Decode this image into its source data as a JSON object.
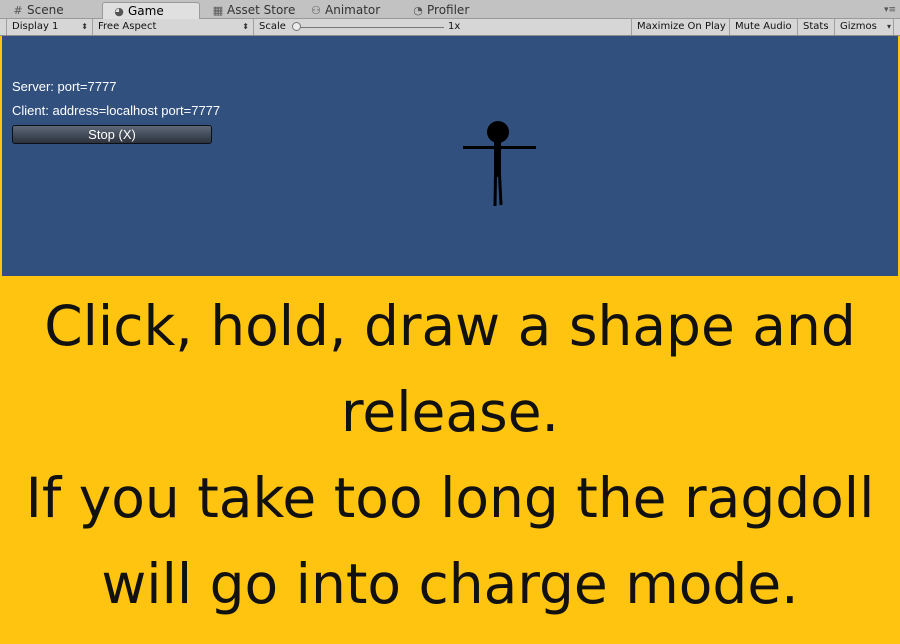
{
  "tabs": [
    {
      "label": "Scene",
      "icon": "grid-icon"
    },
    {
      "label": "Game",
      "icon": "pacman-icon",
      "active": true
    },
    {
      "label": "Asset Store",
      "icon": "store-icon"
    },
    {
      "label": "Animator",
      "icon": "animator-icon"
    },
    {
      "label": "Profiler",
      "icon": "profiler-icon"
    }
  ],
  "toolbar": {
    "display": "Display 1",
    "aspect": "Free Aspect",
    "scale_label": "Scale",
    "scale_value": "1x",
    "maximize": "Maximize On Play",
    "mute": "Mute Audio",
    "stats": "Stats",
    "gizmos": "Gizmos"
  },
  "game": {
    "server_text": "Server: port=7777",
    "client_text": "Client: address=localhost port=7777",
    "stop_button": "Stop (X)",
    "background_color": "#31507e"
  },
  "instructions": {
    "line1": "Click, hold, draw a shape and",
    "line2": "release.",
    "line3": "If you take too long the ragdoll",
    "line4": "will go into charge mode.",
    "background_color": "#ffc40f"
  }
}
